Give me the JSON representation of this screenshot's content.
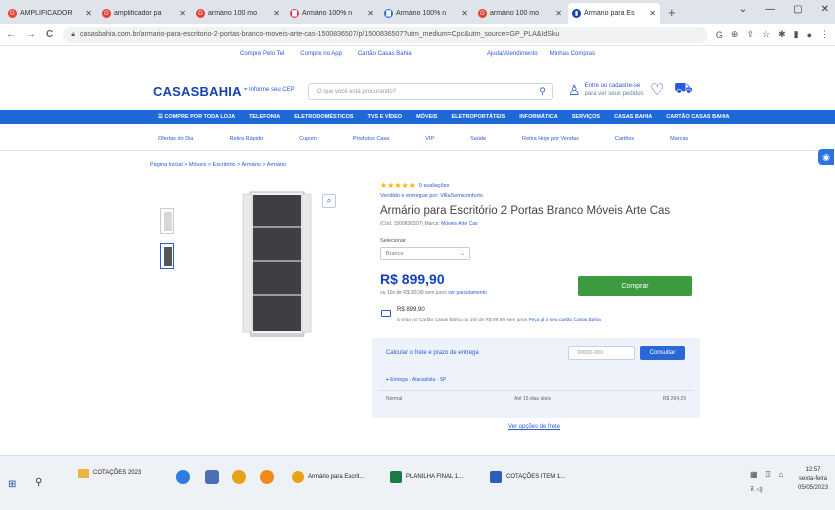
{
  "browser": {
    "tabs": [
      {
        "label": "AMPLIFICADOR",
        "icon_color": "#e34133",
        "icon": "G"
      },
      {
        "label": "amplificador pa",
        "icon_color": "#e34133",
        "icon": "G"
      },
      {
        "label": "armário 100 mo",
        "icon_color": "#e34133",
        "icon": "G"
      },
      {
        "label": "Armário 100% n",
        "icon_color": "#e03a55",
        "icon": "▇"
      },
      {
        "label": "Armário 100% n",
        "icon_color": "#2c6fd8",
        "icon": "▇"
      },
      {
        "label": "armário 100 mo",
        "icon_color": "#e34133",
        "icon": "G"
      },
      {
        "label": "Armário para Es",
        "icon_color": "#1441b4",
        "icon": "▮",
        "active": true
      }
    ],
    "new_tab": "+",
    "url": "casasbahia.com.br/armario-para-escritorio-2-portas-branco-moveis-arte-cas-1500836507/p/1500836507?utm_medium=Cpc&utm_source=GP_PLA&IdSku"
  },
  "site": {
    "top_links": [
      "Compre Pelo Tel",
      "Compre no App",
      "Cartão Casas Bahia"
    ],
    "top_links_right": [
      "Ajuda/Atendimento",
      "Minhas Compras"
    ],
    "logo_a": "CASAS",
    "logo_b": "BAHIA",
    "cep_label": "Informe seu CEP",
    "search_placeholder": "O que você está procurando?",
    "login_line1": "Entre ou cadastre-se",
    "login_line2": "para ver seus pedidos",
    "categories": [
      "COMPRE POR TODA LOJA",
      "TELEFONIA",
      "ELETRODOMÉSTICOS",
      "TVS E VÍDEO",
      "MÓVEIS",
      "ELETROPORTÁTEIS",
      "INFORMÁTICA",
      "SERVIÇOS",
      "CASAS BAHIA",
      "CARTÃO CASAS BAHIA"
    ],
    "subnav": [
      "Ofertas do Dia",
      "Retira Rápido",
      "Cupom",
      "Produtos Casa",
      "VIP",
      "Saúde",
      "Retira Hoje por Vendas",
      "Cartões",
      "Marcas"
    ],
    "breadcrumb": "Página Inicial > Móveis > Escritório > Armário > Armário"
  },
  "product": {
    "stars": "★★★★★",
    "review_count": "0 avaliações",
    "seller": "Vendido e entregue por: VillaSemiconforto",
    "title": "Armário para Escritório 2 Portas Branco Móveis Arte Cas",
    "meta_prefix": "(Cód. 1500836507) Marca:",
    "meta_link": "Móveis Arte Cas",
    "select_label": "Selecionar",
    "select_value": "Branco",
    "price": "R$ 899,90",
    "price_note_prefix": "ou 10x de R$ 89,99 sem juros",
    "price_note_link": "ver parcelamento",
    "buy_label": "Comprar",
    "card_price": "R$ 899,90",
    "card_note_prefix": "à vista no Cartão Casas Bahia ou 10x de R$ 89,99 sem juros",
    "card_note_link": "Peça já o seu cartão Casas Bahia"
  },
  "freight": {
    "label": "Calcular o frete e prazo de entrega",
    "cep_placeholder": "00000-000",
    "button": "Consultar",
    "source": "Entrega · Atacadista · SP",
    "row_left": "Normal",
    "row_mid": "Até 15 dias úteis",
    "row_right": "R$ 264,29",
    "more": "Ver opções de frete"
  },
  "taskbar": {
    "pinned_folder": "COTAÇÕES 2023",
    "windows": [
      "Armário para Escrit...",
      "PLANILHA FINAL 1...",
      "COTAÇÕES ITEM 1..."
    ],
    "time": "12:57",
    "day": "sexta-feira",
    "date": "05/05/2023"
  }
}
